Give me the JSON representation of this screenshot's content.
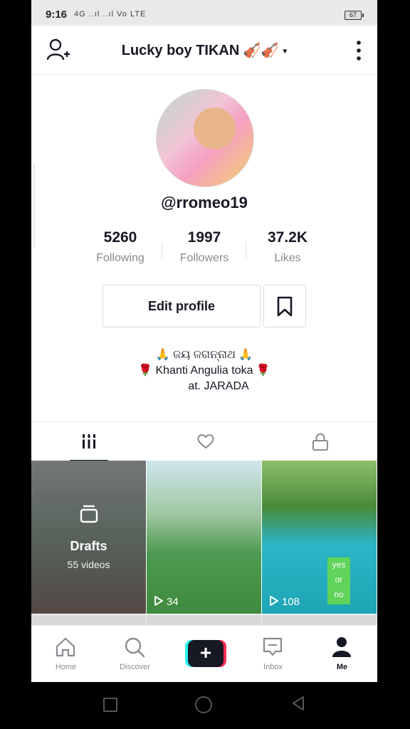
{
  "status_bar": {
    "time": "9:16",
    "signal_text": "4G ..ıl ..ıl Vo LTE",
    "battery": "67"
  },
  "header": {
    "title": "Lucky boy TIKAN 🎻🎻",
    "caret": "▾"
  },
  "profile": {
    "username": "@rromeo19",
    "stats": [
      {
        "value": "5260",
        "label": "Following"
      },
      {
        "value": "1997",
        "label": "Followers"
      },
      {
        "value": "37.2K",
        "label": "Likes"
      }
    ],
    "edit_label": "Edit profile",
    "bio": [
      "🙏 ଜୟ ଜଗନ୍ନାଥ 🙏",
      "🌹 Khanti Angulia toka 🌹",
      "at. JARADA"
    ]
  },
  "tabs": [
    {
      "icon": "videos-grid-icon",
      "active": true
    },
    {
      "icon": "heart-icon",
      "active": false
    },
    {
      "icon": "lock-icon",
      "active": false
    }
  ],
  "videos": {
    "drafts": {
      "title": "Drafts",
      "count": "55 videos"
    },
    "items": [
      {
        "plays": "34"
      },
      {
        "plays": "108",
        "sticker": [
          "yes",
          "or",
          "no"
        ]
      }
    ]
  },
  "bottom_nav": [
    {
      "label": "Home",
      "icon": "home-icon"
    },
    {
      "label": "Discover",
      "icon": "search-icon"
    },
    {
      "label": "",
      "icon": "plus-icon"
    },
    {
      "label": "Inbox",
      "icon": "inbox-icon"
    },
    {
      "label": "Me",
      "icon": "person-icon"
    }
  ],
  "colors": {
    "text_primary": "#161823",
    "text_secondary": "#8a8b91",
    "accent_cyan": "#25f4ee",
    "accent_red": "#fe2c55"
  }
}
